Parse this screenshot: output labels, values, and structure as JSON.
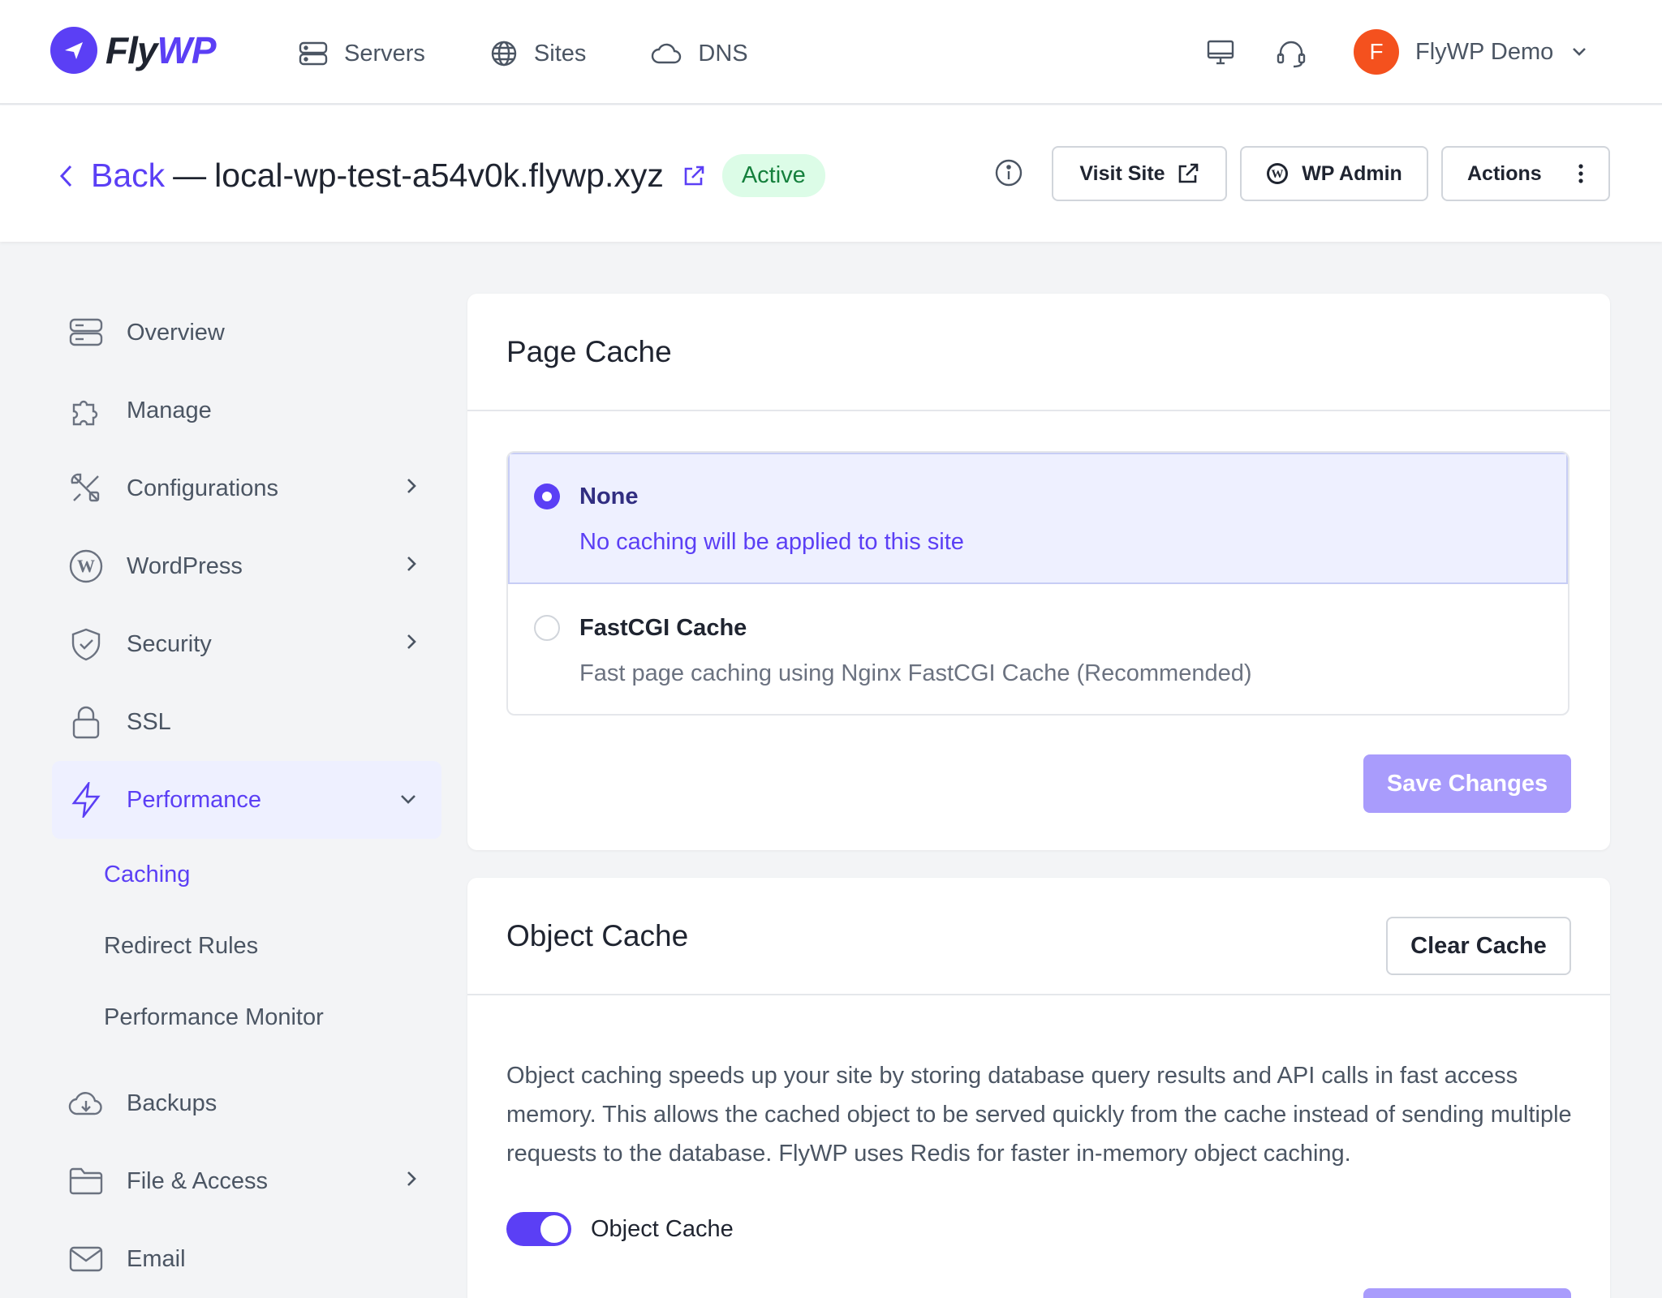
{
  "brand": {
    "fly": "Fly",
    "wp": "WP",
    "accent": "#5b3ff5"
  },
  "nav": {
    "links": [
      {
        "label": "Servers",
        "icon": "server-icon"
      },
      {
        "label": "Sites",
        "icon": "globe-icon"
      },
      {
        "label": "DNS",
        "icon": "cloud-icon"
      }
    ],
    "user": {
      "initial": "F",
      "name": "FlyWP Demo"
    }
  },
  "header": {
    "back_label": "Back",
    "separator": "—",
    "site_name": "local-wp-test-a54v0k.flywp.xyz",
    "status": "Active",
    "visit_label": "Visit Site",
    "wp_admin_label": "WP Admin",
    "actions_label": "Actions"
  },
  "sidebar": {
    "items": [
      {
        "label": "Overview",
        "icon": "server-stack-icon"
      },
      {
        "label": "Manage",
        "icon": "puzzle-icon"
      },
      {
        "label": "Configurations",
        "icon": "tools-icon"
      },
      {
        "label": "WordPress",
        "icon": "wordpress-icon"
      },
      {
        "label": "Security",
        "icon": "shield-icon"
      },
      {
        "label": "SSL",
        "icon": "lock-icon"
      },
      {
        "label": "Performance",
        "icon": "bolt-icon"
      },
      {
        "label": "Backups",
        "icon": "cloud-download-icon"
      },
      {
        "label": "File & Access",
        "icon": "folder-icon"
      },
      {
        "label": "Email",
        "icon": "mail-icon"
      }
    ],
    "performance_sub": [
      "Caching",
      "Redirect Rules",
      "Performance Monitor"
    ]
  },
  "page_cache": {
    "title": "Page Cache",
    "options": [
      {
        "title": "None",
        "desc": "No caching will be applied to this site",
        "selected": true
      },
      {
        "title": "FastCGI Cache",
        "desc": "Fast page caching using Nginx FastCGI Cache (Recommended)",
        "selected": false
      }
    ],
    "save_label": "Save Changes"
  },
  "object_cache": {
    "title": "Object Cache",
    "clear_label": "Clear Cache",
    "description": "Object caching speeds up your site by storing database query results and API calls in fast access memory. This allows the cached object to be served quickly from the cache instead of sending multiple requests to the database. FlyWP uses Redis for faster in-memory object caching.",
    "toggle_label": "Object Cache",
    "toggle_on": true
  }
}
